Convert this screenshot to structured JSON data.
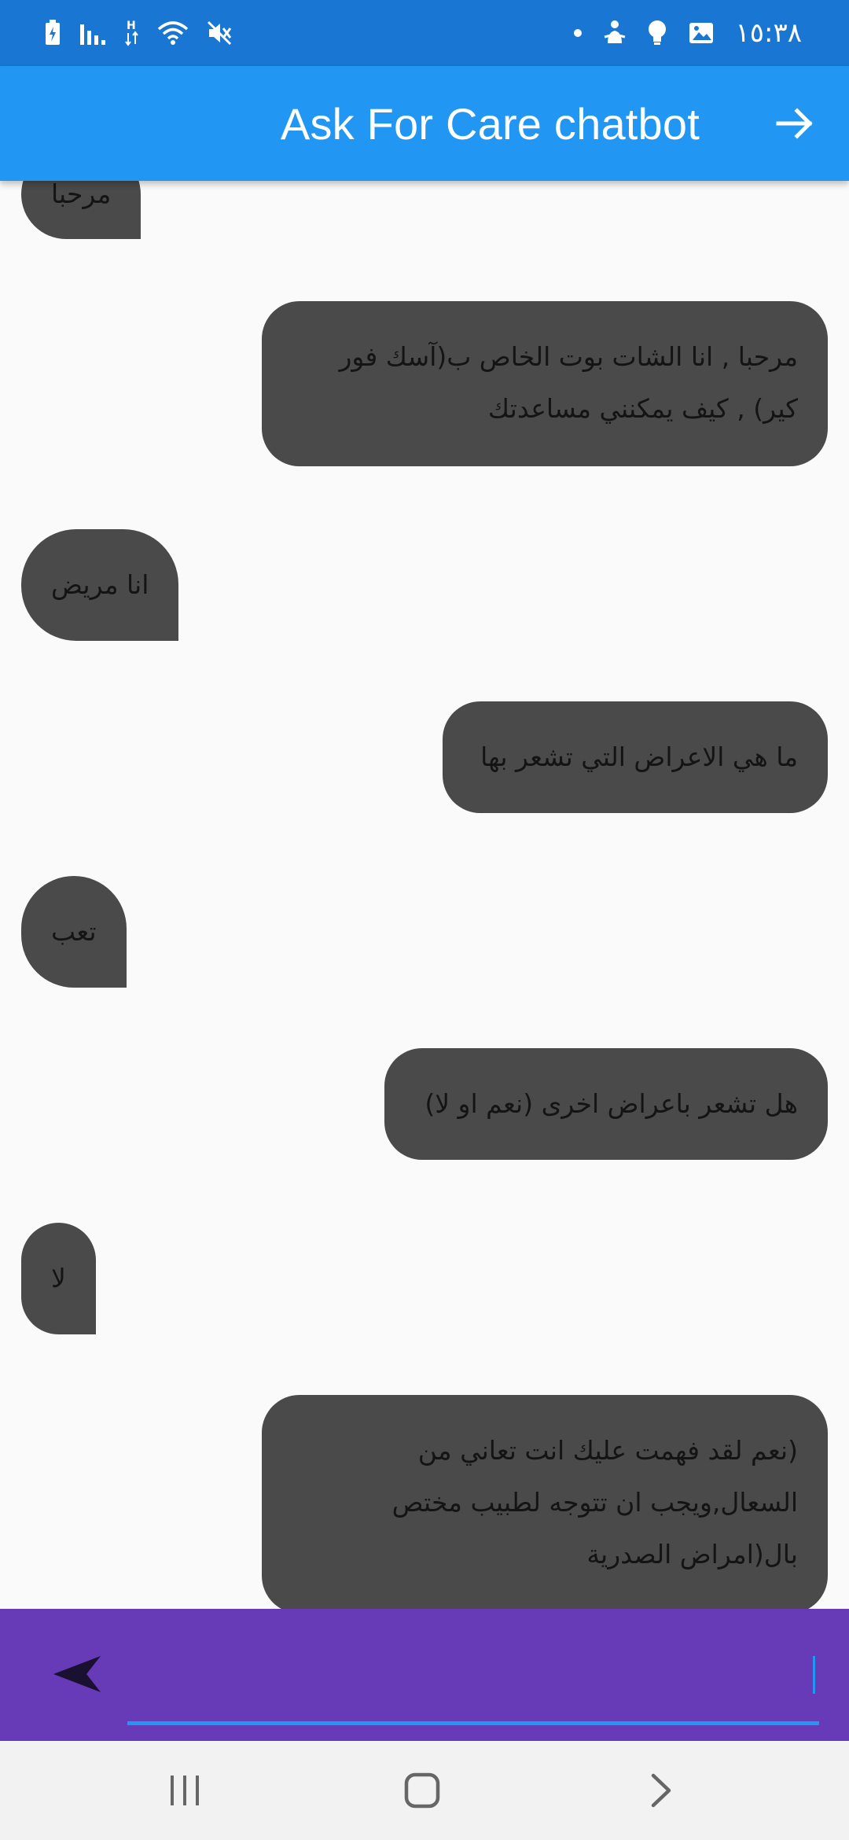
{
  "status_bar": {
    "time": "١٥:٣٨",
    "icons": [
      "battery-charging-icon",
      "signal-icon",
      "h-data-icon",
      "wifi-icon",
      "mute-icon",
      "dot-icon",
      "accessibility-icon",
      "bulb-icon",
      "image-icon"
    ]
  },
  "app_bar": {
    "title": "Ask For Care chatbot",
    "back_icon": "arrow-forward-icon"
  },
  "messages": [
    {
      "sender": "user",
      "lines": [
        "مرحبا"
      ]
    },
    {
      "sender": "bot",
      "lines": [
        "مرحبا , انا الشات بوت الخاص ب(آسك فور",
        "كير) , كيف يمكنني مساعدتك"
      ]
    },
    {
      "sender": "user",
      "lines": [
        "انا مريض"
      ]
    },
    {
      "sender": "bot",
      "lines": [
        "ما هي الاعراض التي تشعر بها"
      ]
    },
    {
      "sender": "user",
      "lines": [
        "تعب"
      ]
    },
    {
      "sender": "bot",
      "lines": [
        "هل تشعر باعراض اخرى (نعم او لا)"
      ]
    },
    {
      "sender": "user",
      "lines": [
        "لا"
      ]
    },
    {
      "sender": "bot",
      "lines": [
        "(نعم لقد فهمت عليك انت تعاني من",
        "السعال,ويجب ان تتوجه لطبيب مختص",
        "بال(امراض الصدرية"
      ]
    }
  ],
  "composer": {
    "value": "",
    "send_icon": "send-icon"
  },
  "nav_bar": {
    "icons": [
      "recent-apps-icon",
      "home-icon",
      "back-icon"
    ]
  },
  "colors": {
    "status_bar": "#1976d2",
    "app_bar": "#2196f3",
    "bubble": "#4a4a4a",
    "input_bar": "#673ab7",
    "input_underline": "#2196f3"
  }
}
